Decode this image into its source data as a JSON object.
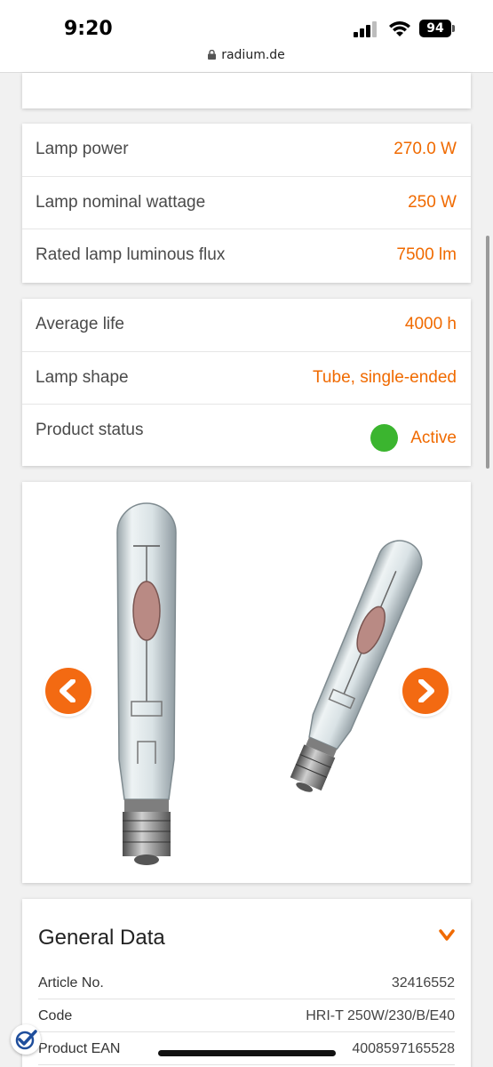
{
  "status_bar": {
    "time": "9:20",
    "battery": "94"
  },
  "browser": {
    "url": "radium.de"
  },
  "specs_group_1": [
    {
      "label": "Lamp power",
      "value": "270.0 W"
    },
    {
      "label": "Lamp nominal wattage",
      "value": "250 W"
    },
    {
      "label": "Rated lamp luminous flux",
      "value": "7500 lm"
    }
  ],
  "specs_group_2": [
    {
      "label": "Average life",
      "value": "4000 h"
    },
    {
      "label": "Lamp shape",
      "value": "Tube, single-ended"
    },
    {
      "label": "Product status",
      "value": "Active"
    }
  ],
  "general_data": {
    "title": "General Data",
    "rows": [
      {
        "label": "Article No.",
        "value": "32416552"
      },
      {
        "label": "Code",
        "value": "HRI-T 250W/230/B/E40"
      },
      {
        "label": "Product EAN",
        "value": "4008597165528"
      }
    ]
  },
  "colors": {
    "accent": "#f06a00",
    "status_active": "#3bb52f",
    "arrow": "#f36a12"
  },
  "icons": [
    "signal-icon",
    "wifi-icon",
    "battery-icon",
    "lock-icon",
    "chevron-left-icon",
    "chevron-right-icon",
    "chevron-down-icon",
    "checkmark-badge-icon"
  ]
}
